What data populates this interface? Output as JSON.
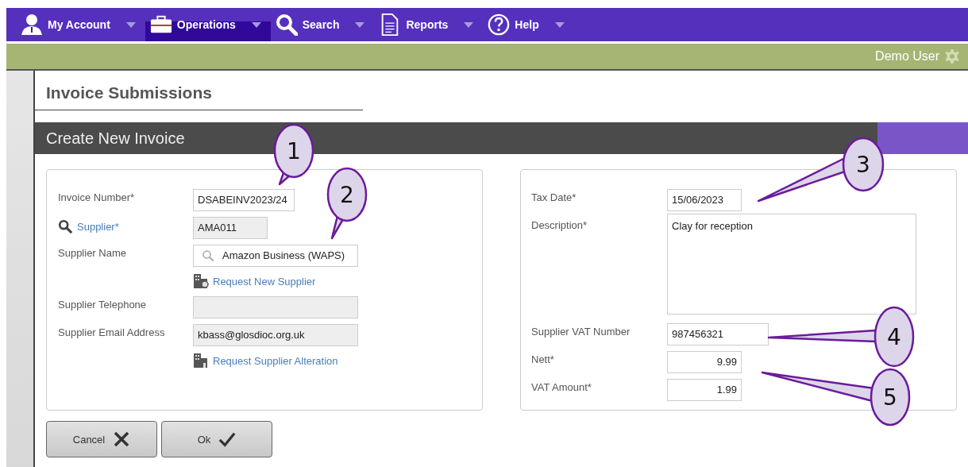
{
  "nav": [
    {
      "label": "My Account",
      "selected": false
    },
    {
      "label": "Operations",
      "selected": true
    },
    {
      "label": "Search",
      "selected": false
    },
    {
      "label": "Reports",
      "selected": false
    },
    {
      "label": "Help",
      "selected": false
    }
  ],
  "user": "Demo User",
  "page_title": "Invoice Submissions",
  "form_title": "Create New Invoice",
  "left_fields": [
    {
      "kind": "text",
      "label": "Invoice Number*",
      "value": "DSABEINV2023/24",
      "readonly": false
    },
    {
      "kind": "lookup",
      "label": "Supplier*",
      "value": "AMA011",
      "readonly": true
    },
    {
      "kind": "search",
      "label": "Supplier Name",
      "value": "Amazon Business (WAPS)",
      "readonly": false
    },
    {
      "kind": "link",
      "label": "Request New Supplier"
    },
    {
      "kind": "text",
      "label": "Supplier Telephone",
      "readonly": true
    },
    {
      "kind": "text",
      "label": "Supplier Email Address",
      "value": "kbass@glosdioc.org.uk",
      "readonly": true
    },
    {
      "kind": "link",
      "label": "Request Supplier Alteration"
    }
  ],
  "right_fields": [
    {
      "kind": "text",
      "label": "Tax Date*",
      "value": "15/06/2023",
      "readonly": false
    },
    {
      "kind": "textarea",
      "label": "Description*",
      "value": "Clay for reception"
    },
    {
      "kind": "text",
      "label": "Supplier VAT Number",
      "value": "987456321",
      "readonly": false
    },
    {
      "kind": "amount",
      "label": "Nett*",
      "value": "9.99",
      "readonly": false
    },
    {
      "kind": "amount",
      "label": "VAT Amount*",
      "value": "1.99",
      "readonly": false
    }
  ],
  "buttons": [
    {
      "label": "Cancel"
    },
    {
      "label": "Ok"
    }
  ],
  "callouts": [
    "1",
    "2",
    "3",
    "4",
    "5"
  ]
}
